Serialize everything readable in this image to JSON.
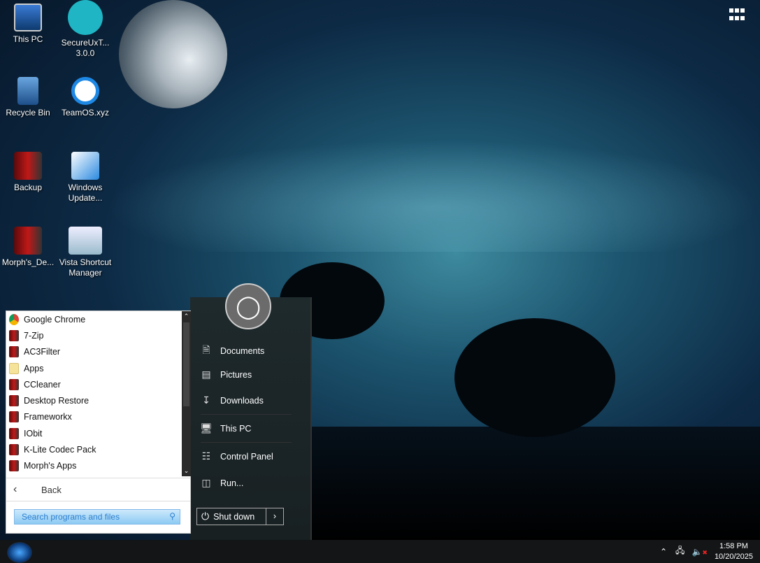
{
  "desktop": {
    "icons": [
      {
        "label": "This PC"
      },
      {
        "label": "SecureUxT... 3.0.0"
      },
      {
        "label": "Recycle Bin"
      },
      {
        "label": "TeamOS.xyz"
      },
      {
        "label": "Backup"
      },
      {
        "label": "Windows Update..."
      },
      {
        "label": "Morph's_De..."
      },
      {
        "label": "Vista Shortcut Manager"
      }
    ]
  },
  "start_menu": {
    "programs": [
      "Google Chrome",
      "7-Zip",
      "AC3Filter",
      "Apps",
      "CCleaner",
      "Desktop Restore",
      "Frameworkx",
      "IObit",
      "K-Lite Codec Pack",
      "Morph's Apps"
    ],
    "back_label": "Back",
    "search_placeholder": "Search programs and files",
    "links": [
      "Documents",
      "Pictures",
      "Downloads",
      "This PC",
      "Control Panel",
      "Run..."
    ],
    "shutdown_label": "Shut down"
  },
  "taskbar": {
    "time": "1:58 PM",
    "date": "10/20/2025"
  }
}
